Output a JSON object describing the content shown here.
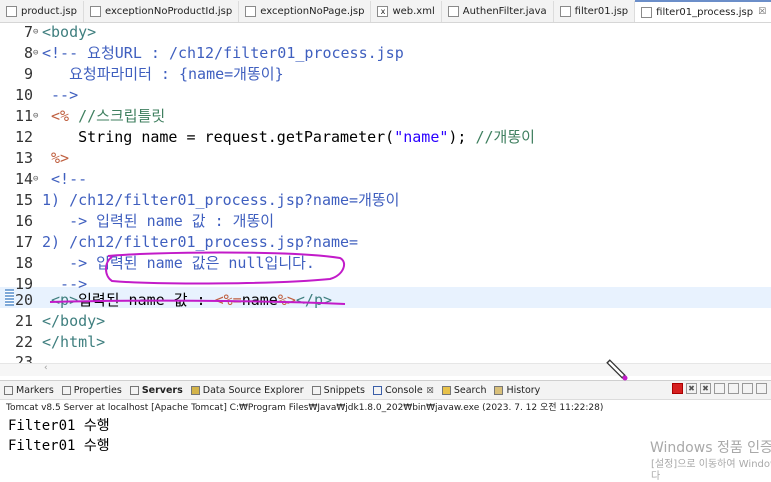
{
  "editor_tabs": [
    {
      "label": "product.jsp",
      "icon": "jsp-file-icon"
    },
    {
      "label": "exceptionNoProductId.jsp",
      "icon": "jsp-file-icon"
    },
    {
      "label": "exceptionNoPage.jsp",
      "icon": "jsp-file-icon"
    },
    {
      "label": "web.xml",
      "icon": "xml-file-icon"
    },
    {
      "label": "AuthenFilter.java",
      "icon": "java-file-icon"
    },
    {
      "label": "filter01.jsp",
      "icon": "jsp-file-icon"
    },
    {
      "label": "filter01_process.jsp",
      "icon": "jsp-file-icon",
      "active": true,
      "close": "☒"
    }
  ],
  "code": {
    "l7": {
      "num": "7",
      "text": "<body>"
    },
    "l8": {
      "num": "8",
      "text": "<!-- 요청URL : /ch12/filter01_process.jsp"
    },
    "l9": {
      "num": "9",
      "text": "   요청파라미터 : {name=개똥이}"
    },
    "l10": {
      "num": "10",
      "text": " -->"
    },
    "l11": {
      "num": "11",
      "open": " <%",
      "rest": " //스크립틀릿"
    },
    "l12": {
      "num": "12",
      "a": "    String name = request.getParameter(",
      "s": "\"name\"",
      "b": "); ",
      "c": "//개똥이"
    },
    "l13": {
      "num": "13",
      "text": " %>"
    },
    "l14": {
      "num": "14",
      "text": " <!--"
    },
    "l15": {
      "num": "15",
      "text": "1) /ch12/filter01_process.jsp?name=개똥이"
    },
    "l16": {
      "num": "16",
      "text": "   -> 입력된 name 값 : 개똥이"
    },
    "l17": {
      "num": "17",
      "text": "2) /ch12/filter01_process.jsp?name="
    },
    "l18": {
      "num": "18",
      "text": "   -> 입력된 name 값은 null입니다."
    },
    "l19": {
      "num": "19",
      "text": "  -->"
    },
    "l20": {
      "num": "20",
      "p1": " <p>",
      "p2": "입력된 name 값 : ",
      "p3": "<%=",
      "p4": "name",
      "p5": "%>",
      "p6": "</p>"
    },
    "l21": {
      "num": "21",
      "text": "</body>"
    },
    "l22": {
      "num": "22",
      "text": "</html>"
    },
    "l23": {
      "num": "23",
      "text": ""
    }
  },
  "view_tabs": [
    {
      "label": "Markers"
    },
    {
      "label": "Properties"
    },
    {
      "label": "Servers",
      "bold": true
    },
    {
      "label": "Data Source Explorer"
    },
    {
      "label": "Snippets"
    },
    {
      "label": "Console",
      "close": "☒"
    },
    {
      "label": "Search"
    },
    {
      "label": "History"
    }
  ],
  "status_line": "Tomcat v8.5 Server at localhost [Apache Tomcat] C:₩Program Files₩Java₩jdk1.8.0_202₩bin₩javaw.exe  (2023. 7. 12 오전 11:22:28)",
  "console_lines": [
    "Filter01 수행",
    "Filter01 수행"
  ],
  "watermark": {
    "line1": "Windows 정품 인증",
    "line2": "[설정]으로 이동하여 Windows",
    "line3": "다"
  },
  "colors": {
    "annotation": "#c21bc9",
    "comment": "#3f5fbf",
    "tag": "#3f7f7f",
    "string": "#2a00ff"
  }
}
